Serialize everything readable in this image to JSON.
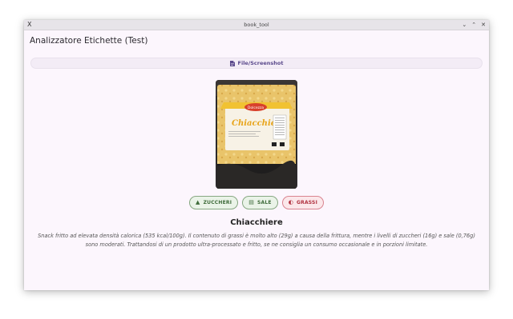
{
  "window": {
    "title": "book_tool",
    "logo": "X"
  },
  "app": {
    "title": "Analizzatore Etichette (Test)"
  },
  "file_button": {
    "label": "File/Screenshot",
    "icon": "file-icon"
  },
  "product_image": {
    "brand_text": "Dolcezza",
    "product_text": "Chiacchiere"
  },
  "chips": [
    {
      "label": "ZUCCHERI",
      "icon": "sugar-icon",
      "status": "ok",
      "color": "#3e6b3a"
    },
    {
      "label": "SALE",
      "icon": "salt-icon",
      "status": "ok",
      "color": "#3e6b3a"
    },
    {
      "label": "GRASSI",
      "icon": "fat-drop-icon",
      "status": "warning",
      "color": "#b0303e"
    }
  ],
  "product": {
    "name": "Chiacchiere",
    "description": "Snack fritto ad elevata densità calorica (535 kcal/100g). Il contenuto di grassi è molto alto (29g) a causa della frittura, mentre i livelli di zuccheri (16g) e sale (0,76g) sono moderati. Trattandosi di un prodotto ultra-processato e fritto, se ne consiglia un consumo occasionale e in porzioni limitate."
  }
}
